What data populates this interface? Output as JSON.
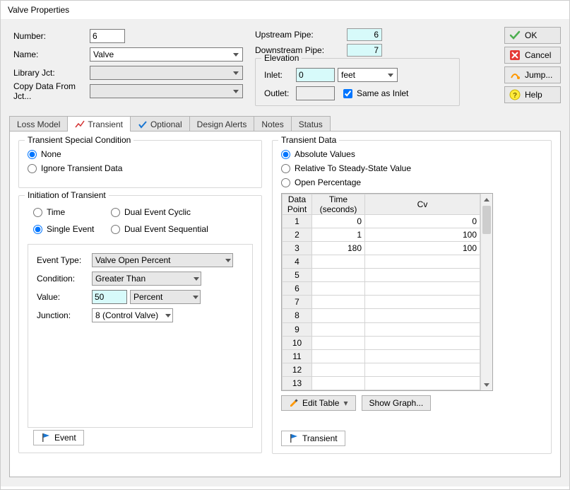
{
  "window": {
    "title": "Valve Properties"
  },
  "top": {
    "number_label": "Number:",
    "number": "6",
    "name_label": "Name:",
    "name": "Valve",
    "library_label": "Library Jct:",
    "library": "",
    "copy_label": "Copy Data From Jct...",
    "copy": ""
  },
  "pipes": {
    "upstream_label": "Upstream Pipe:",
    "upstream": "6",
    "downstream_label": "Downstream Pipe:",
    "downstream": "7"
  },
  "elevation": {
    "title": "Elevation",
    "inlet_label": "Inlet:",
    "inlet": "0",
    "unit": "feet",
    "outlet_label": "Outlet:",
    "outlet": "",
    "same_label": "Same as Inlet",
    "same_checked": true
  },
  "buttons": {
    "ok": "OK",
    "cancel": "Cancel",
    "jump": "Jump...",
    "help": "Help"
  },
  "tabs": {
    "loss": "Loss Model",
    "transient": "Transient",
    "optional": "Optional",
    "design": "Design Alerts",
    "notes": "Notes",
    "status": "Status"
  },
  "tsc": {
    "title": "Transient Special Condition",
    "none": "None",
    "ignore": "Ignore Transient Data",
    "selected": "none"
  },
  "init": {
    "title": "Initiation of Transient",
    "time": "Time",
    "single": "Single Event",
    "cyclic": "Dual Event Cyclic",
    "seq": "Dual Event Sequential",
    "selected": "single",
    "event_type_label": "Event Type:",
    "event_type": "Valve Open Percent",
    "condition_label": "Condition:",
    "condition": "Greater Than",
    "value_label": "Value:",
    "value": "50",
    "value_unit": "Percent",
    "junction_label": "Junction:",
    "junction": "8 (Control Valve)"
  },
  "tdata": {
    "title": "Transient Data",
    "absolute": "Absolute Values",
    "relative": "Relative To Steady-State Value",
    "openpct": "Open Percentage",
    "selected": "absolute",
    "col_point": "Data\nPoint",
    "col_time": "Time\n(seconds)",
    "col_cv": "Cv",
    "chart_data": {
      "type": "table",
      "columns": [
        "Data Point",
        "Time (seconds)",
        "Cv"
      ],
      "rows": [
        {
          "point": 1,
          "time": 0,
          "cv": 0
        },
        {
          "point": 2,
          "time": 1,
          "cv": 100
        },
        {
          "point": 3,
          "time": 180,
          "cv": 100
        },
        {
          "point": 4,
          "time": null,
          "cv": null
        },
        {
          "point": 5,
          "time": null,
          "cv": null
        },
        {
          "point": 6,
          "time": null,
          "cv": null
        },
        {
          "point": 7,
          "time": null,
          "cv": null
        },
        {
          "point": 8,
          "time": null,
          "cv": null
        },
        {
          "point": 9,
          "time": null,
          "cv": null
        },
        {
          "point": 10,
          "time": null,
          "cv": null
        },
        {
          "point": 11,
          "time": null,
          "cv": null
        },
        {
          "point": 12,
          "time": null,
          "cv": null
        },
        {
          "point": 13,
          "time": null,
          "cv": null
        }
      ]
    },
    "edit_table": "Edit Table",
    "show_graph": "Show Graph..."
  },
  "bottom_tabs": {
    "event": "Event",
    "transient": "Transient"
  }
}
